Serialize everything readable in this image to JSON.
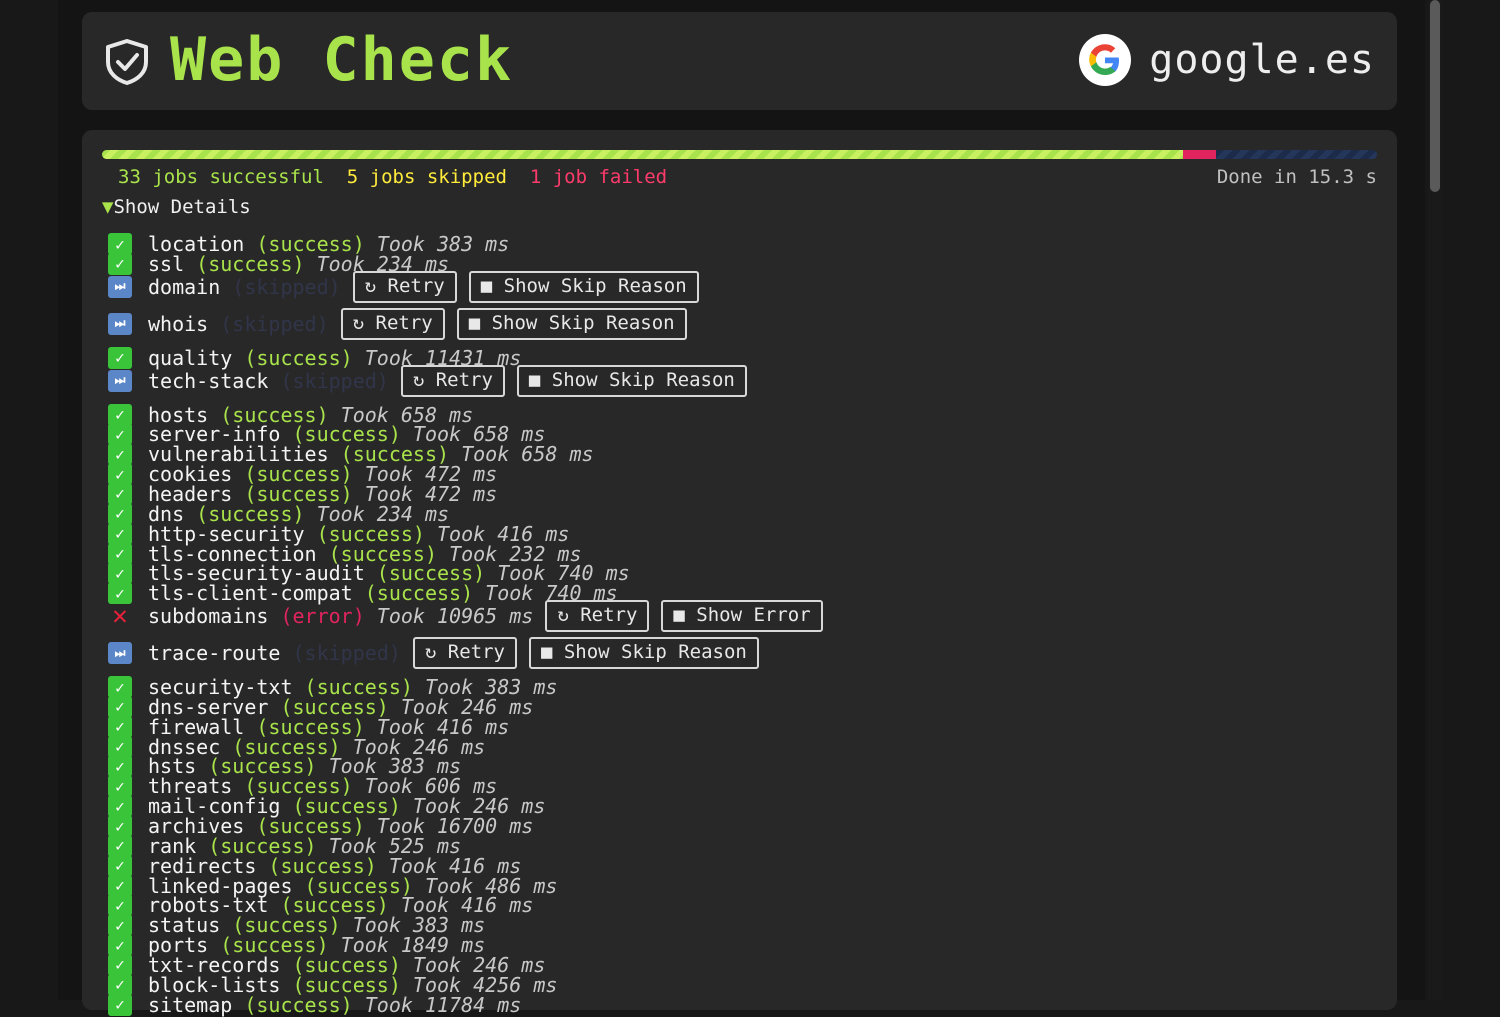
{
  "header": {
    "title": "Web Check",
    "site": "google.es",
    "accent": "#a9e34b"
  },
  "summary": {
    "successful": "33 jobs successful",
    "skipped": "5 jobs skipped",
    "failed": "1 job failed",
    "done": "Done in 15.3 s",
    "progress": {
      "success_fraction": 0.848,
      "failed_fraction": 0.026
    }
  },
  "details_toggle": "Show Details",
  "labels": {
    "retry": "↻ Retry",
    "show_skip": "■ Show Skip Reason",
    "show_error": "■ Show Error"
  },
  "jobs": [
    {
      "name": "location",
      "status": "success",
      "took": "Took 383 ms"
    },
    {
      "name": "ssl",
      "status": "success",
      "took": "Took 234 ms"
    },
    {
      "name": "domain",
      "status": "skipped",
      "took": ""
    },
    {
      "name": "whois",
      "status": "skipped",
      "took": ""
    },
    {
      "name": "quality",
      "status": "success",
      "took": "Took 11431 ms"
    },
    {
      "name": "tech-stack",
      "status": "skipped",
      "took": ""
    },
    {
      "name": "hosts",
      "status": "success",
      "took": "Took 658 ms"
    },
    {
      "name": "server-info",
      "status": "success",
      "took": "Took 658 ms"
    },
    {
      "name": "vulnerabilities",
      "status": "success",
      "took": "Took 658 ms"
    },
    {
      "name": "cookies",
      "status": "success",
      "took": "Took 472 ms"
    },
    {
      "name": "headers",
      "status": "success",
      "took": "Took 472 ms"
    },
    {
      "name": "dns",
      "status": "success",
      "took": "Took 234 ms"
    },
    {
      "name": "http-security",
      "status": "success",
      "took": "Took 416 ms"
    },
    {
      "name": "tls-connection",
      "status": "success",
      "took": "Took 232 ms"
    },
    {
      "name": "tls-security-audit",
      "status": "success",
      "took": "Took 740 ms"
    },
    {
      "name": "tls-client-compat",
      "status": "success",
      "took": "Took 740 ms"
    },
    {
      "name": "subdomains",
      "status": "error",
      "took": "Took 10965 ms"
    },
    {
      "name": "trace-route",
      "status": "skipped",
      "took": ""
    },
    {
      "name": "security-txt",
      "status": "success",
      "took": "Took 383 ms"
    },
    {
      "name": "dns-server",
      "status": "success",
      "took": "Took 246 ms"
    },
    {
      "name": "firewall",
      "status": "success",
      "took": "Took 416 ms"
    },
    {
      "name": "dnssec",
      "status": "success",
      "took": "Took 246 ms"
    },
    {
      "name": "hsts",
      "status": "success",
      "took": "Took 383 ms"
    },
    {
      "name": "threats",
      "status": "success",
      "took": "Took 606 ms"
    },
    {
      "name": "mail-config",
      "status": "success",
      "took": "Took 246 ms"
    },
    {
      "name": "archives",
      "status": "success",
      "took": "Took 16700 ms"
    },
    {
      "name": "rank",
      "status": "success",
      "took": "Took 525 ms"
    },
    {
      "name": "redirects",
      "status": "success",
      "took": "Took 416 ms"
    },
    {
      "name": "linked-pages",
      "status": "success",
      "took": "Took 486 ms"
    },
    {
      "name": "robots-txt",
      "status": "success",
      "took": "Took 416 ms"
    },
    {
      "name": "status",
      "status": "success",
      "took": "Took 383 ms"
    },
    {
      "name": "ports",
      "status": "success",
      "took": "Took 1849 ms"
    },
    {
      "name": "txt-records",
      "status": "success",
      "took": "Took 246 ms"
    },
    {
      "name": "block-lists",
      "status": "success",
      "took": "Took 4256 ms"
    },
    {
      "name": "sitemap",
      "status": "success",
      "took": "Took 11784 ms"
    }
  ]
}
